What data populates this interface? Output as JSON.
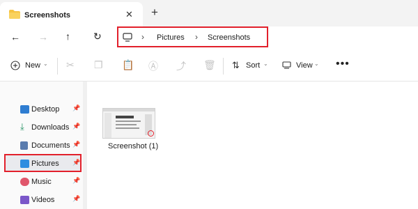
{
  "window": {
    "tab_title": "Screenshots",
    "tab_close_icon": "close-icon",
    "new_tab_icon": "plus-icon"
  },
  "nav": {
    "back_icon": "back-arrow-icon",
    "forward_icon": "forward-arrow-icon",
    "up_icon": "up-arrow-icon",
    "refresh_icon": "refresh-icon",
    "breadcrumb": [
      "Pictures",
      "Screenshots"
    ],
    "computer_icon": "monitor-icon"
  },
  "toolbar": {
    "new_label": "New",
    "sort_label": "Sort",
    "view_label": "View",
    "more_icon": "more-icon"
  },
  "sidebar": {
    "items": [
      {
        "label": "Desktop",
        "icon": "desktop-icon",
        "color": "#2f7dd1"
      },
      {
        "label": "Downloads",
        "icon": "download-icon",
        "color": "#1f8f5f"
      },
      {
        "label": "Documents",
        "icon": "documents-icon",
        "color": "#5a7cae"
      },
      {
        "label": "Pictures",
        "icon": "pictures-icon",
        "color": "#2e8de0"
      },
      {
        "label": "Music",
        "icon": "music-icon",
        "color": "#e0566b"
      },
      {
        "label": "Videos",
        "icon": "videos-icon",
        "color": "#7b57c9"
      }
    ]
  },
  "files": [
    {
      "name": "Screenshot (1)"
    }
  ],
  "colors": {
    "highlight": "#e2202b",
    "folder": "#f5c342"
  }
}
